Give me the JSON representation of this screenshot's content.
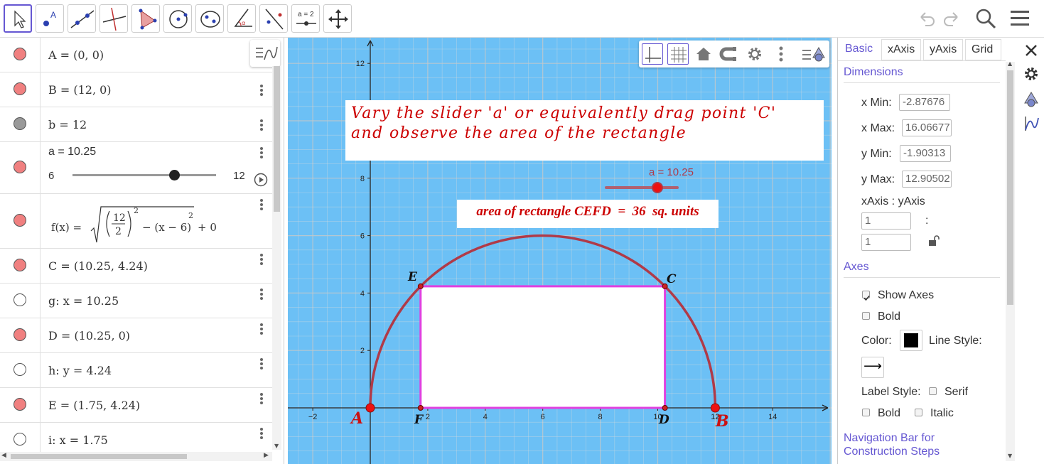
{
  "toolbar": {
    "tools": [
      "move-tool",
      "point-tool",
      "line-tool",
      "perpendicular-line-tool",
      "polygon-tool",
      "circle-center-point-tool",
      "ellipse-tool",
      "angle-tool",
      "reflect-about-line-tool",
      "slider-tool",
      "move-graphics-view-tool"
    ],
    "slider_tool_label": "a = 2"
  },
  "algebra": {
    "rows": [
      {
        "text": "A = (0, 0)",
        "color": "#f08080"
      },
      {
        "text": "B = (12, 0)",
        "color": "#f08080"
      },
      {
        "text": "b = 12",
        "color": "#999999"
      },
      {
        "text": "a = 10.25",
        "slider_min": "6",
        "slider_max": "12",
        "value": 10.25,
        "color": "#f08080"
      },
      {
        "text": "f(x) = √((12/2)² − (x − 6)²) + 0",
        "color": "#f08080"
      },
      {
        "text": "C = (10.25, 4.24)",
        "color": "#f08080"
      },
      {
        "text": "g: x = 10.25",
        "color": "#ffffff"
      },
      {
        "text": "D = (10.25, 0)",
        "color": "#f08080"
      },
      {
        "text": "h: y = 4.24",
        "color": "#ffffff"
      },
      {
        "text": "E = (1.75, 4.24)",
        "color": "#f08080"
      },
      {
        "text": "i: x = 1.75",
        "color": "#ffffff"
      }
    ],
    "formula": {
      "prefix": "f(x) =",
      "num": "12",
      "den": "2",
      "exp": "2",
      "tail": "− (x − 6)",
      "tail_exp": "2",
      "plus": "+ 0"
    }
  },
  "graphics": {
    "instruction_line1": "Vary the slider 'a' or equivalently drag point 'C'",
    "instruction_line2": "and observe the area of the rectangle",
    "slider_label": "a = 10.25",
    "slider_value": 10.25,
    "area_text": "area of rectangle CEFD  =  36  sq. units",
    "x_ticks": [
      "−2",
      "2",
      "4",
      "6",
      "8",
      "10",
      "12",
      "14"
    ],
    "y_ticks": [
      "2",
      "4",
      "6",
      "8",
      "12"
    ],
    "point_labels": {
      "A": "A",
      "B": "B",
      "C": "C",
      "D": "D",
      "E": "E",
      "F": "F"
    },
    "colors": {
      "background": "#6cc0f5",
      "semicircle": "#b03a48",
      "rectangle": "#e040e0",
      "text_red": "#cc0000"
    }
  },
  "properties": {
    "tabs": [
      "Basic",
      "xAxis",
      "yAxis",
      "Grid"
    ],
    "dimensions_title": "Dimensions",
    "x_min_label": "x Min:",
    "x_min": "-2.87676",
    "x_max_label": "x Max:",
    "x_max": "16.06677",
    "y_min_label": "y Min:",
    "y_min": "-1.90313",
    "y_max_label": "y Max:",
    "y_max": "12.90502",
    "ratio_label": "xAxis : yAxis",
    "ratio_x": "1",
    "ratio_sep": ":",
    "ratio_y": "1",
    "axes_title": "Axes",
    "show_axes": "Show Axes",
    "bold": "Bold",
    "color_label": "Color:",
    "line_style_label": "Line Style:",
    "line_style_value": "⟶",
    "label_style_label": "Label Style:",
    "serif": "Serif",
    "bold2": "Bold",
    "italic": "Italic",
    "nav_title_1": "Navigation Bar for",
    "nav_title_2": "Construction Steps"
  }
}
